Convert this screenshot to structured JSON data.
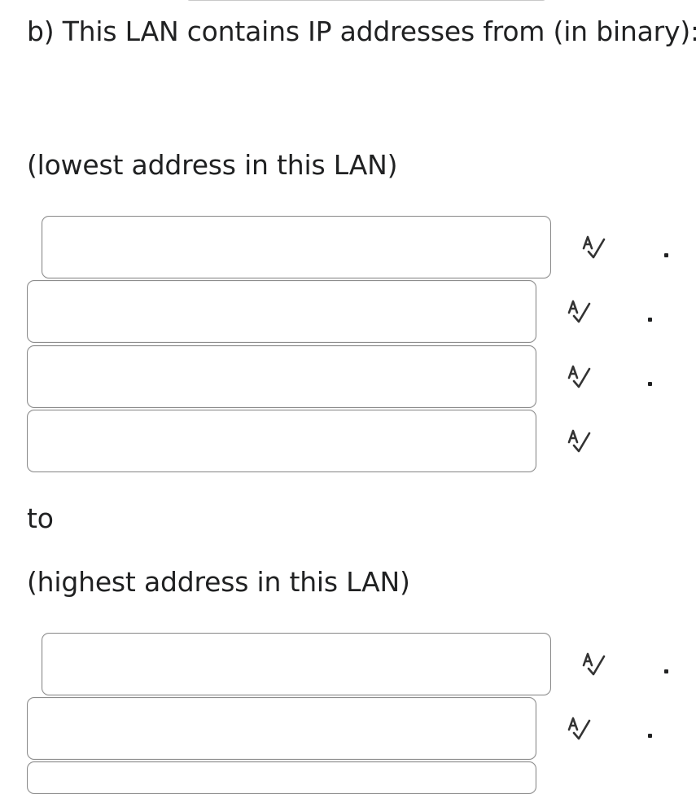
{
  "question": {
    "part_label": "b) This LAN contains IP addresses from (in binary):",
    "lowest_label": "(lowest address in this LAN)",
    "to_label": "to",
    "highest_label": "(highest address in this LAN)"
  },
  "lowest_octets": [
    {
      "value": ""
    },
    {
      "value": ""
    },
    {
      "value": ""
    },
    {
      "value": ""
    }
  ],
  "highest_octets": [
    {
      "value": ""
    },
    {
      "value": ""
    },
    {
      "value": ""
    }
  ],
  "icons": {
    "spellcheck": "spellcheck-icon"
  },
  "colors": {
    "text": "#202122",
    "field_border": "#8c8c8c",
    "icon": "#333333"
  }
}
